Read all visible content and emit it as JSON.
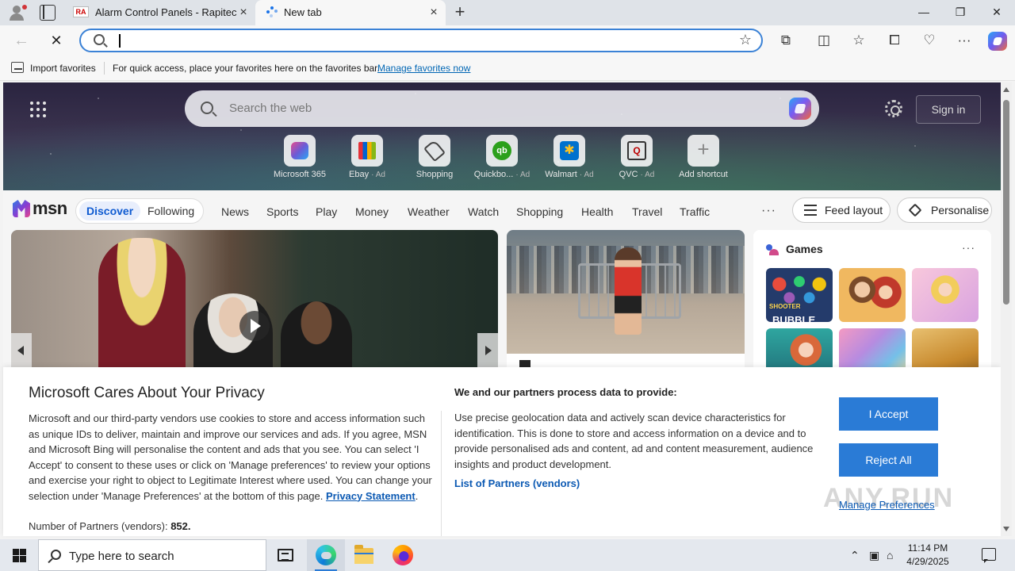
{
  "browser": {
    "tabs": [
      {
        "title": "Alarm Control Panels - Rapitec",
        "favicon_text": "RA"
      },
      {
        "title": "New tab"
      }
    ],
    "address_bar": {
      "value": "",
      "placeholder": ""
    },
    "favorites_bar": {
      "import_label": "Import favorites",
      "hint": "For quick access, place your favorites here on the favorites bar.",
      "manage_link": "Manage favorites now"
    }
  },
  "msn": {
    "search_placeholder": "Search the web",
    "sign_in": "Sign in",
    "shortcuts": [
      {
        "label": "Microsoft 365",
        "ad": ""
      },
      {
        "label": "Ebay",
        "ad": "· Ad"
      },
      {
        "label": "Shopping",
        "ad": ""
      },
      {
        "label": "Quickbo...",
        "ad": "· Ad",
        "icon_text": "qb"
      },
      {
        "label": "Walmart",
        "ad": "· Ad",
        "icon_text": "✱"
      },
      {
        "label": "QVC",
        "ad": "· Ad",
        "icon_text": "Q"
      },
      {
        "label": "Add shortcut",
        "ad": ""
      }
    ],
    "logo_text": "msn",
    "tabs": {
      "discover": "Discover",
      "following": "Following"
    },
    "nav": [
      "News",
      "Sports",
      "Play",
      "Money",
      "Weather",
      "Watch",
      "Shopping",
      "Health",
      "Travel",
      "Traffic"
    ],
    "more": "···",
    "feed_layout": "Feed layout",
    "personalise": "Personalise",
    "games": {
      "title": "Games",
      "more": "···",
      "tile1_text": "BUBBLE",
      "tile1_sub": "SHOOTER"
    }
  },
  "privacy": {
    "title": "Microsoft Cares About Your Privacy",
    "body": "Microsoft and our third-party vendors use cookies to store and access information such as unique IDs to deliver, maintain and improve our services and ads. If you agree, MSN and Microsoft Bing will personalise the content and ads that you see. You can select 'I Accept' to consent to these uses or click on 'Manage preferences' to review your options and exercise your right to object to Legitimate Interest where used.  You can change your selection under 'Manage Preferences' at the bottom of this page.",
    "privacy_link": "Privacy Statement",
    "partners_label": "Number of Partners (vendors):",
    "partners_count": "852.",
    "heading2": "We and our partners process data to provide:",
    "body2": "Use precise geolocation data and actively scan device characteristics for identification. This is done to store and access information on a device and to provide personalised ads and content, ad and content measurement, audience insights and product development.",
    "list_link": "List of Partners (vendors)",
    "accept": "I Accept",
    "reject": "Reject All",
    "manage": "Manage Preferences"
  },
  "watermark": "ANY.RUN",
  "taskbar": {
    "search_placeholder": "Type here to search",
    "time": "11:14 PM",
    "date": "4/29/2025"
  }
}
